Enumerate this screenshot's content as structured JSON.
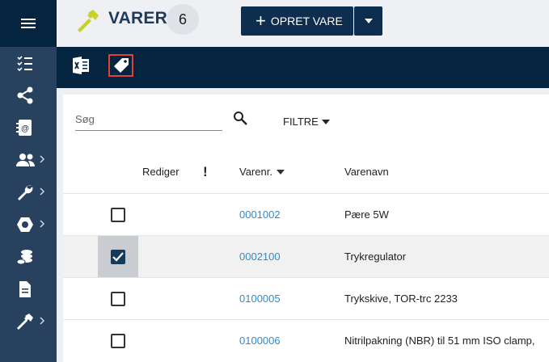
{
  "colors": {
    "sidebar": "#27415e",
    "toolbar": "#042440",
    "accent": "#2d8ccd",
    "highlight": "#e0403a"
  },
  "header": {
    "title": "VARER",
    "count": "6",
    "create_label": "OPRET VARE"
  },
  "search": {
    "placeholder": "Søg"
  },
  "filter": {
    "label": "FILTRE"
  },
  "columns": {
    "rediger": "Rediger",
    "alert": "!",
    "varenr": "Varenr.",
    "varenavn": "Varenavn"
  },
  "rows": [
    {
      "varenr": "0001002",
      "varenavn": "Pære 5W",
      "checked": false
    },
    {
      "varenr": "0002100",
      "varenavn": "Trykregulator",
      "checked": true
    },
    {
      "varenr": "0100005",
      "varenavn": "Trykskive, TOR-trc 2233",
      "checked": false
    },
    {
      "varenr": "0100006",
      "varenavn": "Nitrilpakning (NBR) til 51 mm ISO clamp,",
      "checked": false
    }
  ],
  "sidebar_icons": [
    "menu-icon",
    "checklist-icon",
    "share-icon",
    "contacts-icon",
    "users-icon",
    "wrench-icon",
    "nut-icon",
    "coins-icon",
    "document-icon",
    "hammer-icon"
  ],
  "toolbar_icons": [
    "excel-icon",
    "tag-icon"
  ]
}
